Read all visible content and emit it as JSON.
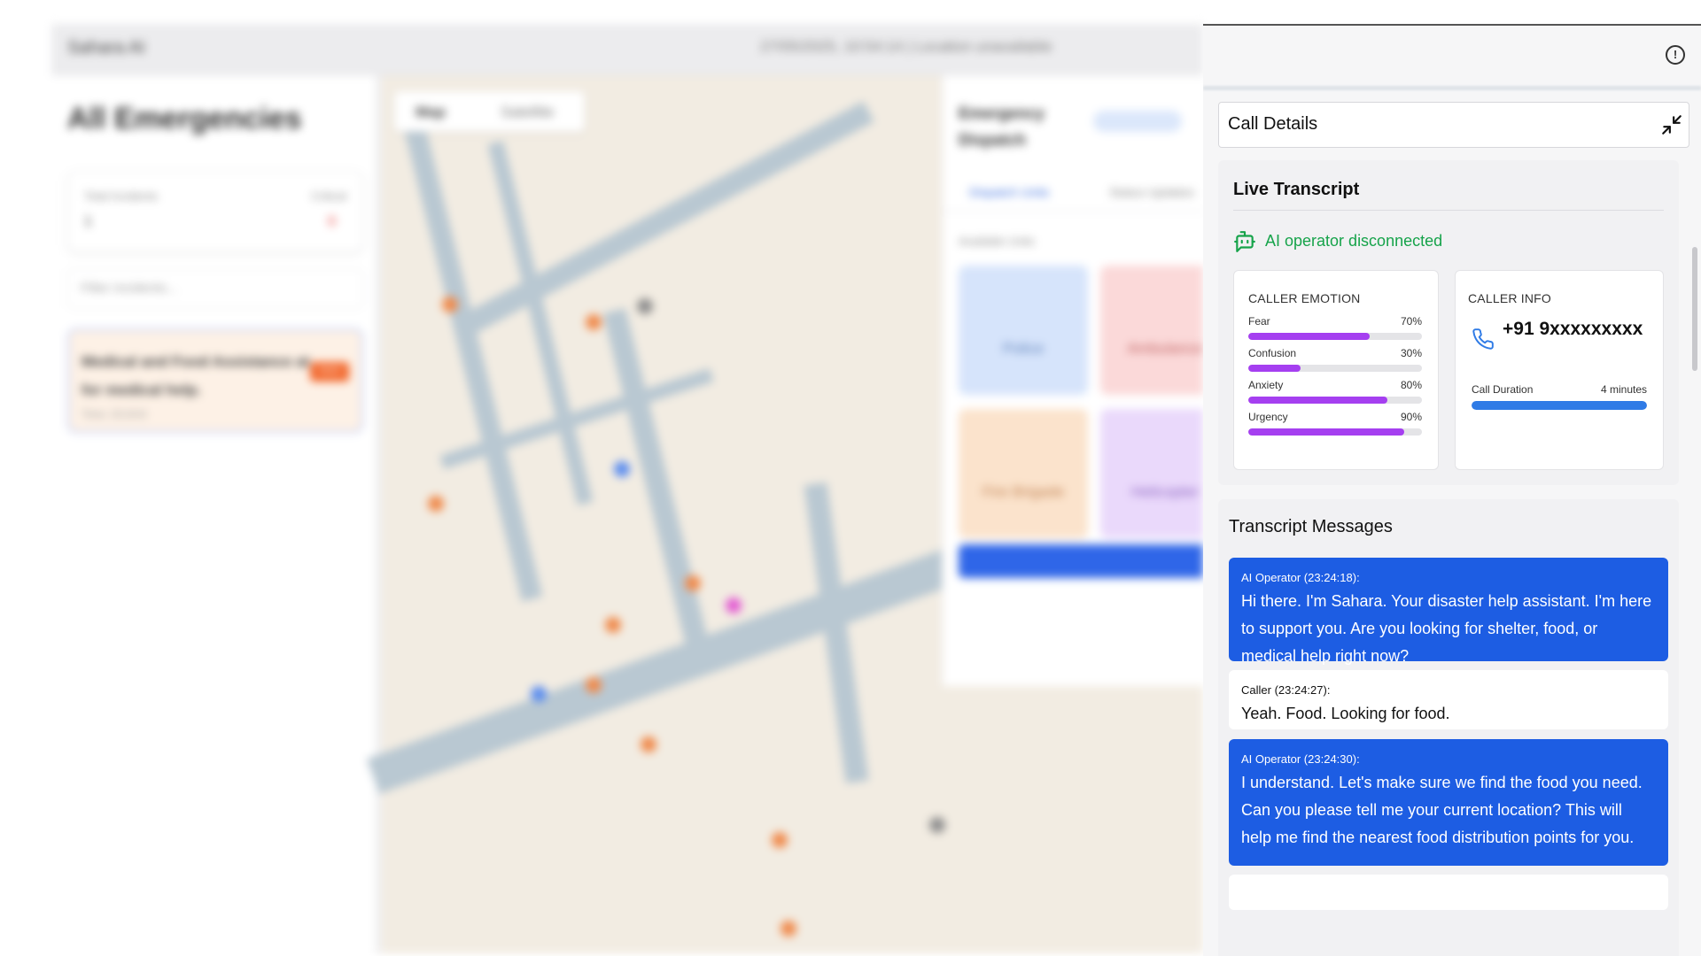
{
  "background_app": {
    "brand": "Sahara AI",
    "status_line": "27/05/2025, 10:54:14 | Location unavailable",
    "page_title": "All Emergencies",
    "stats": {
      "total_label": "Total Incidents",
      "total_value": "1",
      "critical_label": "Critical",
      "critical_value": "0"
    },
    "filter_placeholder": "Filter incidents...",
    "incident": {
      "title": "Medical and Food Assistance at for medical help.",
      "badge": "HIGH",
      "time": "Time: 23:24:8"
    },
    "map_tabs": [
      "Map",
      "Satellite"
    ],
    "dispatch": {
      "title": "Emergency Dispatch",
      "tabs": [
        "Dispatch Units",
        "Status Updates"
      ],
      "available_label": "Available Units",
      "units": [
        "Police",
        "Ambulance",
        "Fire Brigade",
        "Helicopter"
      ]
    }
  },
  "panel": {
    "call_details_title": "Call Details",
    "live_transcript": {
      "title": "Live Transcript",
      "ai_status": "AI operator disconnected",
      "status_color": "#16a34a"
    },
    "caller_emotion": {
      "title": "CALLER EMOTION",
      "bar_color": "#a53ff0",
      "items": [
        {
          "label": "Fear",
          "value": "70%",
          "fraction": 0.7
        },
        {
          "label": "Confusion",
          "value": "30%",
          "fraction": 0.3
        },
        {
          "label": "Anxiety",
          "value": "80%",
          "fraction": 0.8
        },
        {
          "label": "Urgency",
          "value": "90%",
          "fraction": 0.9
        }
      ]
    },
    "caller_info": {
      "title": "CALLER INFO",
      "phone": "+91 9xxxxxxxxx",
      "duration_label": "Call Duration",
      "duration_value": "4 minutes",
      "duration_fraction": 1.0
    },
    "transcript": {
      "title": "Transcript Messages",
      "messages": [
        {
          "speaker": "ai",
          "header": "AI Operator (23:24:18):",
          "text": "Hi there. I'm Sahara. Your disaster help assistant. I'm here to support you. Are you looking for shelter, food, or medical help right now?"
        },
        {
          "speaker": "caller",
          "header": "Caller (23:24:27):",
          "text": "Yeah. Food. Looking for food."
        },
        {
          "speaker": "ai",
          "header": "AI Operator (23:24:30):",
          "text": "I understand. Let's make sure we find the food you need. Can you please tell me your current location? This will help me find the nearest food distribution points for you."
        }
      ]
    }
  }
}
